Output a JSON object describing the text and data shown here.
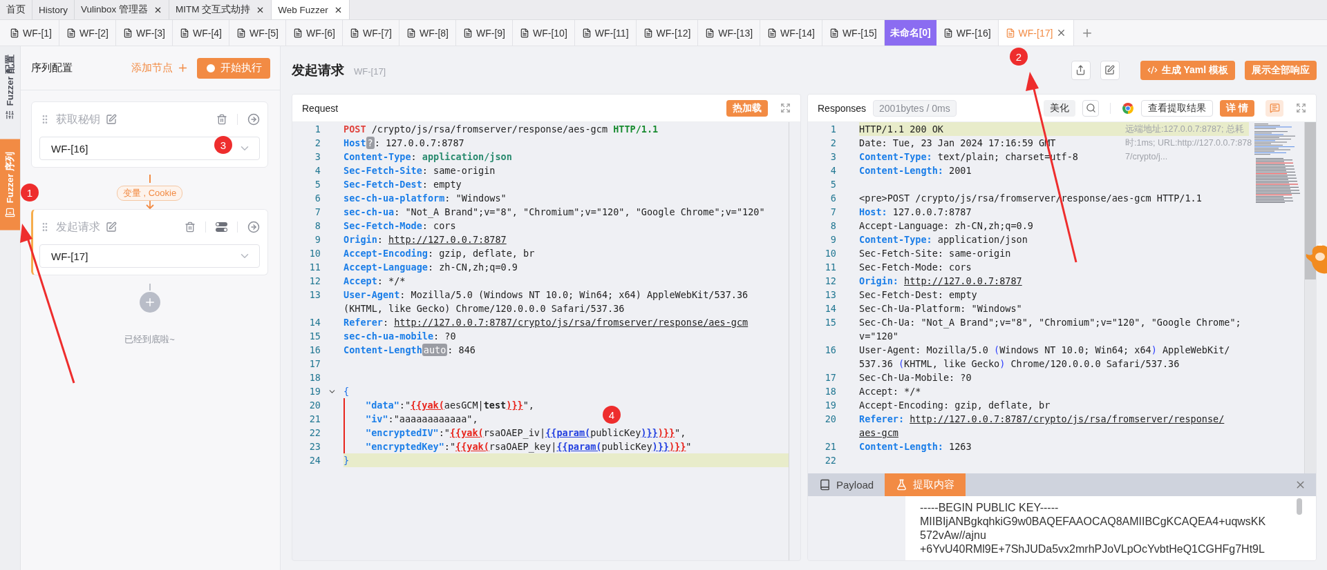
{
  "top_tabs": [
    {
      "label": "首页",
      "selected": false
    },
    {
      "label": "History",
      "selected": false
    },
    {
      "label": "Vulinbox 管理器",
      "selected": false,
      "closable": true
    },
    {
      "label": "MITM 交互式劫持",
      "selected": false,
      "closable": true
    },
    {
      "label": "Web Fuzzer",
      "selected": true,
      "closable": true
    }
  ],
  "wf_tabs": [
    {
      "kind": "tab",
      "label": "WF-[1]",
      "selected": false
    },
    {
      "kind": "tab",
      "label": "WF-[2]",
      "selected": false
    },
    {
      "kind": "tab",
      "label": "WF-[3]",
      "selected": false
    },
    {
      "kind": "tab",
      "label": "WF-[4]",
      "selected": false
    },
    {
      "kind": "tab",
      "label": "WF-[5]",
      "selected": false
    },
    {
      "kind": "tab",
      "label": "WF-[6]",
      "selected": false
    },
    {
      "kind": "tab",
      "label": "WF-[7]",
      "selected": false
    },
    {
      "kind": "tab",
      "label": "WF-[8]",
      "selected": false
    },
    {
      "kind": "tab",
      "label": "WF-[9]",
      "selected": false
    },
    {
      "kind": "tab",
      "label": "WF-[10]",
      "selected": false
    },
    {
      "kind": "tab",
      "label": "WF-[11]",
      "selected": false
    },
    {
      "kind": "tab",
      "label": "WF-[12]",
      "selected": false
    },
    {
      "kind": "tab",
      "label": "WF-[13]",
      "selected": false
    },
    {
      "kind": "tab",
      "label": "WF-[14]",
      "selected": false
    },
    {
      "kind": "tab",
      "label": "WF-[15]",
      "selected": false
    },
    {
      "kind": "group",
      "label": "未命名[0]"
    },
    {
      "kind": "tab",
      "label": "WF-[16]",
      "selected": false
    },
    {
      "kind": "tab",
      "label": "WF-[17]",
      "selected": true,
      "closable": true
    }
  ],
  "side_tabs": [
    {
      "label": "Fuzzer 配置",
      "selected": false
    },
    {
      "label": "Fuzzer 序列",
      "selected": true
    }
  ],
  "sequence": {
    "title": "序列配置",
    "add_label": "添加节点",
    "run_label": "开始执行",
    "nodes": [
      {
        "name": "获取秘钥",
        "target": "WF-[16]",
        "selected": false,
        "has_toggle": false
      },
      {
        "name": "发起请求",
        "target": "WF-[17]",
        "selected": true,
        "has_toggle": true
      }
    ],
    "connectors": [
      "变量 , Cookie"
    ],
    "end_text": "已经到底啦~"
  },
  "header": {
    "title": "发起请求",
    "subtitle": "WF-[17]",
    "yaml_button": "生成 Yaml 模板",
    "show_all_button": "展示全部响应"
  },
  "request": {
    "title": "Request",
    "hot_reload": "热加载",
    "lines": [
      {
        "n": "1",
        "highlighted": false,
        "segments": [
          {
            "tokens": [
              {
                "kind": "method",
                "text": "POST"
              },
              {
                "kind": "plain",
                "text": " /crypto/js/rsa/fromserver/response/aes-gcm "
              },
              {
                "kind": "proto",
                "text": "HTTP/1.1"
              }
            ]
          }
        ]
      },
      {
        "n": "2",
        "highlighted": false,
        "segments": [
          {
            "tokens": [
              {
                "kind": "key",
                "text": "Host"
              },
              {
                "kind": "badge",
                "text": "?"
              },
              {
                "kind": "plain",
                "text": ": 127.0.0.7:8787"
              }
            ]
          }
        ]
      },
      {
        "n": "3",
        "highlighted": false,
        "segments": [
          {
            "tokens": [
              {
                "kind": "key",
                "text": "Content-Type"
              },
              {
                "kind": "plain",
                "text": ": "
              },
              {
                "kind": "val",
                "text": "application/json"
              }
            ]
          }
        ]
      },
      {
        "n": "4",
        "highlighted": false,
        "segments": [
          {
            "tokens": [
              {
                "kind": "key",
                "text": "Sec-Fetch-Site"
              },
              {
                "kind": "plain",
                "text": ": same-origin"
              }
            ]
          }
        ]
      },
      {
        "n": "5",
        "highlighted": false,
        "segments": [
          {
            "tokens": [
              {
                "kind": "key",
                "text": "Sec-Fetch-Dest"
              },
              {
                "kind": "plain",
                "text": ": empty"
              }
            ]
          }
        ]
      },
      {
        "n": "6",
        "highlighted": false,
        "segments": [
          {
            "tokens": [
              {
                "kind": "key",
                "text": "sec-ch-ua-platform"
              },
              {
                "kind": "plain",
                "text": ": \"Windows\""
              }
            ]
          }
        ]
      },
      {
        "n": "7",
        "highlighted": false,
        "segments": [
          {
            "tokens": [
              {
                "kind": "key",
                "text": "sec-ch-ua"
              },
              {
                "kind": "plain",
                "text": ": \"Not_A Brand\";v=\"8\", \"Chromium\";v=\"120\", \"Google Chrome\";v=\"120\""
              }
            ]
          }
        ]
      },
      {
        "n": "8",
        "highlighted": false,
        "segments": [
          {
            "tokens": [
              {
                "kind": "key",
                "text": "Sec-Fetch-Mode"
              },
              {
                "kind": "plain",
                "text": ": cors"
              }
            ]
          }
        ]
      },
      {
        "n": "9",
        "highlighted": false,
        "segments": [
          {
            "tokens": [
              {
                "kind": "key",
                "text": "Origin"
              },
              {
                "kind": "plain",
                "text": ": "
              },
              {
                "kind": "url",
                "text": "http://127.0.0.7:8787"
              }
            ]
          }
        ]
      },
      {
        "n": "10",
        "highlighted": false,
        "segments": [
          {
            "tokens": [
              {
                "kind": "key",
                "text": "Accept-Encoding"
              },
              {
                "kind": "plain",
                "text": ": gzip, deflate, br"
              }
            ]
          }
        ]
      },
      {
        "n": "11",
        "highlighted": false,
        "segments": [
          {
            "tokens": [
              {
                "kind": "key",
                "text": "Accept-Language"
              },
              {
                "kind": "plain",
                "text": ": zh-CN,zh;q=0.9"
              }
            ]
          }
        ]
      },
      {
        "n": "12",
        "highlighted": false,
        "segments": [
          {
            "tokens": [
              {
                "kind": "key",
                "text": "Accept"
              },
              {
                "kind": "plain",
                "text": ": */*"
              }
            ]
          }
        ]
      },
      {
        "n": "13",
        "highlighted": false,
        "segments": [
          {
            "tokens": [
              {
                "kind": "key",
                "text": "User-Agent"
              },
              {
                "kind": "plain",
                "text": ": Mozilla/5.0 (Windows NT 10.0; Win64; x64) AppleWebKit/537.36"
              }
            ]
          },
          {
            "tokens": [
              {
                "kind": "plain",
                "text": "(KHTML, like Gecko) Chrome/120.0.0.0 Safari/537.36"
              }
            ]
          }
        ]
      },
      {
        "n": "14",
        "highlighted": false,
        "segments": [
          {
            "tokens": [
              {
                "kind": "key",
                "text": "Referer"
              },
              {
                "kind": "plain",
                "text": ": "
              },
              {
                "kind": "url",
                "text": "http://127.0.0.7:8787/crypto/js/rsa/fromserver/response/aes-gcm"
              }
            ]
          }
        ]
      },
      {
        "n": "15",
        "highlighted": false,
        "segments": [
          {
            "tokens": [
              {
                "kind": "key",
                "text": "sec-ch-ua-mobile"
              },
              {
                "kind": "plain",
                "text": ": ?0"
              }
            ]
          }
        ]
      },
      {
        "n": "16",
        "highlighted": false,
        "segments": [
          {
            "tokens": [
              {
                "kind": "key",
                "text": "Content-Length"
              },
              {
                "kind": "badge",
                "text": "auto"
              },
              {
                "kind": "plain",
                "text": ": 846"
              }
            ]
          }
        ]
      },
      {
        "n": "17",
        "highlighted": false
      },
      {
        "n": "18",
        "highlighted": false
      },
      {
        "n": "19",
        "highlighted": false,
        "fold": true,
        "segments": [
          {
            "tokens": [
              {
                "kind": "brace",
                "text": "{"
              }
            ]
          }
        ]
      },
      {
        "n": "20",
        "highlighted": false,
        "guide": true,
        "segments": [
          {
            "tokens": [
              {
                "kind": "jkey",
                "text": "\"data\""
              },
              {
                "kind": "plain",
                "text": ":\""
              },
              {
                "kind": "tagr",
                "text": "{{yak("
              },
              {
                "kind": "plain",
                "text": "aesGCM|"
              },
              {
                "kind": "bold",
                "text": "test"
              },
              {
                "kind": "tagr",
                "text": ")}}"
              },
              {
                "kind": "plain",
                "text": "\","
              }
            ]
          }
        ]
      },
      {
        "n": "21",
        "highlighted": false,
        "guide": true,
        "segments": [
          {
            "tokens": [
              {
                "kind": "jkey",
                "text": "\"iv\""
              },
              {
                "kind": "plain",
                "text": ":\"aaaaaaaaaaaa\","
              }
            ]
          }
        ]
      },
      {
        "n": "22",
        "highlighted": false,
        "guide": true,
        "segments": [
          {
            "tokens": [
              {
                "kind": "jkey",
                "text": "\"encryptedIV\""
              },
              {
                "kind": "plain",
                "text": ":\""
              },
              {
                "kind": "tagr",
                "text": "{{yak("
              },
              {
                "kind": "plain",
                "text": "rsaOAEP_iv|"
              },
              {
                "kind": "tagb",
                "text": "{{param("
              },
              {
                "kind": "plain",
                "text": "publicKey"
              },
              {
                "kind": "tagb",
                "text": ")}}"
              },
              {
                "kind": "tagr",
                "text": ")}}"
              },
              {
                "kind": "plain",
                "text": "\","
              }
            ]
          }
        ]
      },
      {
        "n": "23",
        "highlighted": false,
        "guide": true,
        "segments": [
          {
            "tokens": [
              {
                "kind": "jkey",
                "text": "\"encryptedKey\""
              },
              {
                "kind": "plain",
                "text": ":\""
              },
              {
                "kind": "tagr",
                "text": "{{yak("
              },
              {
                "kind": "plain",
                "text": "rsaOAEP_key|"
              },
              {
                "kind": "tagb",
                "text": "{{param("
              },
              {
                "kind": "plain",
                "text": "publicKey"
              },
              {
                "kind": "tagb",
                "text": ")}}"
              },
              {
                "kind": "tagr",
                "text": ")}}"
              },
              {
                "kind": "plain",
                "text": "\""
              }
            ]
          }
        ]
      },
      {
        "n": "24",
        "highlighted": true,
        "segments": [
          {
            "tokens": [
              {
                "kind": "brace",
                "text": "}"
              }
            ]
          }
        ]
      }
    ]
  },
  "response": {
    "title": "Responses",
    "stats": "2001bytes / 0ms",
    "beautify": "美化",
    "extract_button": "查看提取结果",
    "detail_button": "详 情",
    "side_note": "远端地址:127.0.0.7:8787; 总耗时:1ms; URL:http://127.0.0.7:8787/crypto/j...",
    "lines": [
      {
        "n": "1",
        "highlighted": true,
        "segments": [
          {
            "tokens": [
              {
                "kind": "plain",
                "text": "HTTP/1.1 200 OK"
              }
            ]
          }
        ]
      },
      {
        "n": "2",
        "highlighted": false,
        "segments": [
          {
            "tokens": [
              {
                "kind": "plain",
                "text": "Date: Tue, 23 Jan 2024 17:16:59 GMT"
              }
            ]
          }
        ]
      },
      {
        "n": "3",
        "highlighted": false,
        "segments": [
          {
            "tokens": [
              {
                "kind": "key",
                "text": "Content-Type:"
              },
              {
                "kind": "plain",
                "text": " text/plain; charset=utf-8"
              }
            ]
          }
        ]
      },
      {
        "n": "4",
        "highlighted": false,
        "segments": [
          {
            "tokens": [
              {
                "kind": "key",
                "text": "Content-Length:"
              },
              {
                "kind": "plain",
                "text": " 2001"
              }
            ]
          }
        ]
      },
      {
        "n": "5",
        "highlighted": false
      },
      {
        "n": "6",
        "highlighted": false,
        "segments": [
          {
            "tokens": [
              {
                "kind": "plain",
                "text": "<pre>POST /crypto/js/rsa/fromserver/response/aes-gcm HTTP/1.1"
              }
            ]
          }
        ]
      },
      {
        "n": "7",
        "highlighted": false,
        "segments": [
          {
            "tokens": [
              {
                "kind": "key",
                "text": "Host:"
              },
              {
                "kind": "plain",
                "text": " 127.0.0.7:8787"
              }
            ]
          }
        ]
      },
      {
        "n": "8",
        "highlighted": false,
        "segments": [
          {
            "tokens": [
              {
                "kind": "plain",
                "text": "Accept-Language: zh-CN,zh;q=0.9"
              }
            ]
          }
        ]
      },
      {
        "n": "9",
        "highlighted": false,
        "segments": [
          {
            "tokens": [
              {
                "kind": "key",
                "text": "Content-Type:"
              },
              {
                "kind": "plain",
                "text": " application/json"
              }
            ]
          }
        ]
      },
      {
        "n": "10",
        "highlighted": false,
        "segments": [
          {
            "tokens": [
              {
                "kind": "plain",
                "text": "Sec-Fetch-Site: same-origin"
              }
            ]
          }
        ]
      },
      {
        "n": "11",
        "highlighted": false,
        "segments": [
          {
            "tokens": [
              {
                "kind": "plain",
                "text": "Sec-Fetch-Mode: cors"
              }
            ]
          }
        ]
      },
      {
        "n": "12",
        "highlighted": false,
        "segments": [
          {
            "tokens": [
              {
                "kind": "key",
                "text": "Origin: "
              },
              {
                "kind": "url",
                "text": "http://127.0.0.7:8787"
              }
            ]
          }
        ]
      },
      {
        "n": "13",
        "highlighted": false,
        "segments": [
          {
            "tokens": [
              {
                "kind": "plain",
                "text": "Sec-Fetch-Dest: empty"
              }
            ]
          }
        ]
      },
      {
        "n": "14",
        "highlighted": false,
        "segments": [
          {
            "tokens": [
              {
                "kind": "plain",
                "text": "Sec-Ch-Ua-Platform: \"Windows\""
              }
            ]
          }
        ]
      },
      {
        "n": "15",
        "highlighted": false,
        "segments": [
          {
            "tokens": [
              {
                "kind": "plain",
                "text": "Sec-Ch-Ua: \"Not_A Brand\";v=\"8\", \"Chromium\";v=\"120\", \"Google Chrome\";"
              }
            ]
          },
          {
            "tokens": [
              {
                "kind": "plain",
                "text": "v=\"120\""
              }
            ]
          }
        ]
      },
      {
        "n": "16",
        "highlighted": false,
        "segments": [
          {
            "tokens": [
              {
                "kind": "plain",
                "text": "User-Agent: Mozilla/5.0 "
              },
              {
                "kind": "paren",
                "text": "("
              },
              {
                "kind": "plain",
                "text": "Windows NT 10.0; Win64; x64"
              },
              {
                "kind": "paren",
                "text": ")"
              },
              {
                "kind": "plain",
                "text": " AppleWebKit/"
              }
            ]
          },
          {
            "tokens": [
              {
                "kind": "plain",
                "text": "537.36 "
              },
              {
                "kind": "paren",
                "text": "("
              },
              {
                "kind": "plain",
                "text": "KHTML, like Gecko"
              },
              {
                "kind": "paren",
                "text": ")"
              },
              {
                "kind": "plain",
                "text": " Chrome/120.0.0.0 Safari/537.36"
              }
            ]
          }
        ]
      },
      {
        "n": "17",
        "highlighted": false,
        "segments": [
          {
            "tokens": [
              {
                "kind": "plain",
                "text": "Sec-Ch-Ua-Mobile: ?0"
              }
            ]
          }
        ]
      },
      {
        "n": "18",
        "highlighted": false,
        "segments": [
          {
            "tokens": [
              {
                "kind": "plain",
                "text": "Accept: */*"
              }
            ]
          }
        ]
      },
      {
        "n": "19",
        "highlighted": false,
        "segments": [
          {
            "tokens": [
              {
                "kind": "plain",
                "text": "Accept-Encoding: gzip, deflate, br"
              }
            ]
          }
        ]
      },
      {
        "n": "20",
        "highlighted": false,
        "segments": [
          {
            "tokens": [
              {
                "kind": "key",
                "text": "Referer: "
              },
              {
                "kind": "url",
                "text": "http://127.0.0.7:8787/crypto/js/rsa/fromserver/response/"
              }
            ]
          },
          {
            "tokens": [
              {
                "kind": "url",
                "text": "aes-gcm"
              }
            ]
          }
        ]
      },
      {
        "n": "21",
        "highlighted": false,
        "segments": [
          {
            "tokens": [
              {
                "kind": "key",
                "text": "Content-Length:"
              },
              {
                "kind": "plain",
                "text": " 1263"
              }
            ]
          }
        ]
      },
      {
        "n": "22",
        "highlighted": false
      }
    ]
  },
  "bottom": {
    "tabs": [
      {
        "label": "Payload",
        "selected": false
      },
      {
        "label": "提取内容",
        "selected": true
      }
    ],
    "content": [
      "-----BEGIN PUBLIC KEY-----",
      "MIIBIjANBgkqhkiG9w0BAQEFAAOCAQ8AMIIBCgKCAQEA4+uqwsKK",
      "572vAw//ajnu",
      "+6YvU40RMl9E+7ShJUDa5vx2mrhPJoVLpOcYvbtHeQ1CGHFg7Ht9L"
    ]
  },
  "annotations": {
    "markers": [
      "1",
      "2",
      "3",
      "4"
    ]
  }
}
